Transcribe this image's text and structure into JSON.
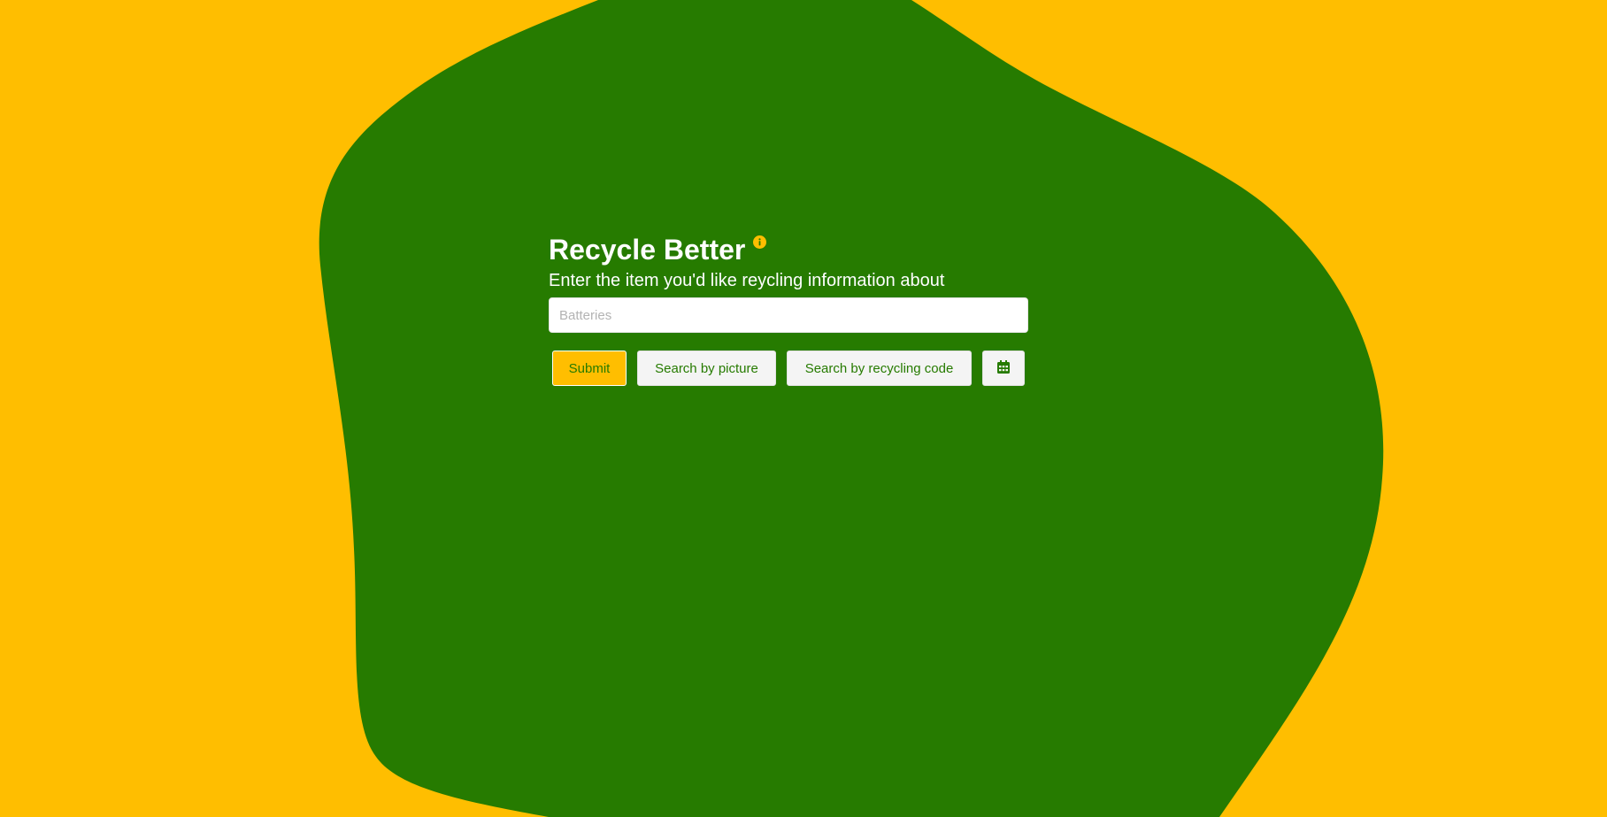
{
  "app": {
    "title": "Recycle Better",
    "subtitle": "Enter the item you'd like reycling information about"
  },
  "search": {
    "placeholder": "Batteries",
    "value": ""
  },
  "buttons": {
    "submit": "Submit",
    "search_by_picture": "Search by picture",
    "search_by_code": "Search by recycling code"
  },
  "icons": {
    "info": "info-icon",
    "calendar": "calendar-icon"
  },
  "colors": {
    "background": "#FFBE00",
    "blob": "#267B00",
    "accent": "#FFBE00",
    "text_on_green": "#FFFFFF",
    "button_text": "#267B00"
  }
}
